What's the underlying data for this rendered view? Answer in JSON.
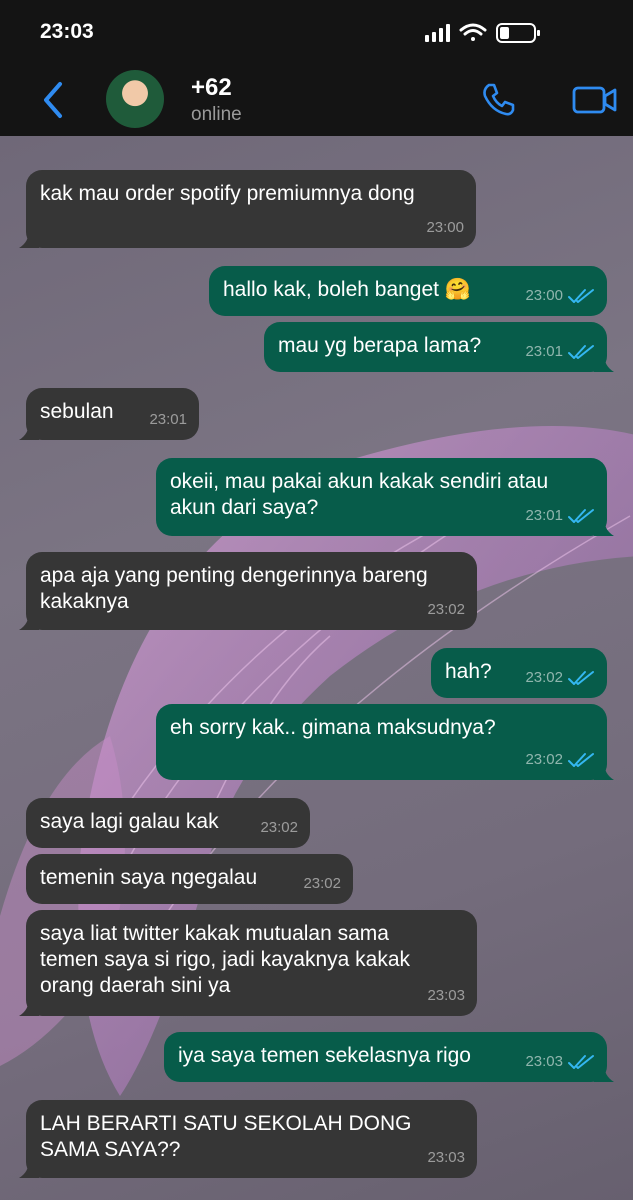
{
  "status_bar": {
    "time": "23:03"
  },
  "header": {
    "name": "+62",
    "status": "online"
  },
  "colors": {
    "accent": "#2f8bf0",
    "incoming": "#363636",
    "outgoing": "#075c4a",
    "read_ticks": "#34b7f1"
  },
  "messages": [
    {
      "dir": "in",
      "text": "kak mau order spotify premiumnya dong",
      "time": "23:00"
    },
    {
      "dir": "out",
      "text": "hallo kak, boleh banget 🤗",
      "time": "23:00",
      "read": true
    },
    {
      "dir": "out",
      "text": "mau yg berapa lama?",
      "time": "23:01",
      "read": true
    },
    {
      "dir": "in",
      "text": "sebulan",
      "time": "23:01"
    },
    {
      "dir": "out",
      "text": "okeii, mau pakai akun kakak sendiri atau\nakun dari saya?",
      "time": "23:01",
      "read": true
    },
    {
      "dir": "in",
      "text": "apa aja yang penting dengerinnya bareng\nkakaknya",
      "time": "23:02"
    },
    {
      "dir": "out",
      "text": "hah?",
      "time": "23:02",
      "read": true
    },
    {
      "dir": "out",
      "text": "eh sorry kak.. gimana maksudnya?",
      "time": "23:02",
      "read": true
    },
    {
      "dir": "in",
      "text": "saya lagi galau kak",
      "time": "23:02"
    },
    {
      "dir": "in",
      "text": "temenin saya ngegalau",
      "time": "23:02"
    },
    {
      "dir": "in",
      "text": "saya liat twitter kakak mutualan sama\ntemen saya si rigo, jadi kayaknya kakak\norang daerah sini ya",
      "time": "23:03"
    },
    {
      "dir": "out",
      "text": "iya saya temen sekelasnya rigo",
      "time": "23:03",
      "read": true
    },
    {
      "dir": "in",
      "text": "LAH BERARTI SATU SEKOLAH DONG\nSAMA SAYA??",
      "time": "23:03"
    }
  ]
}
